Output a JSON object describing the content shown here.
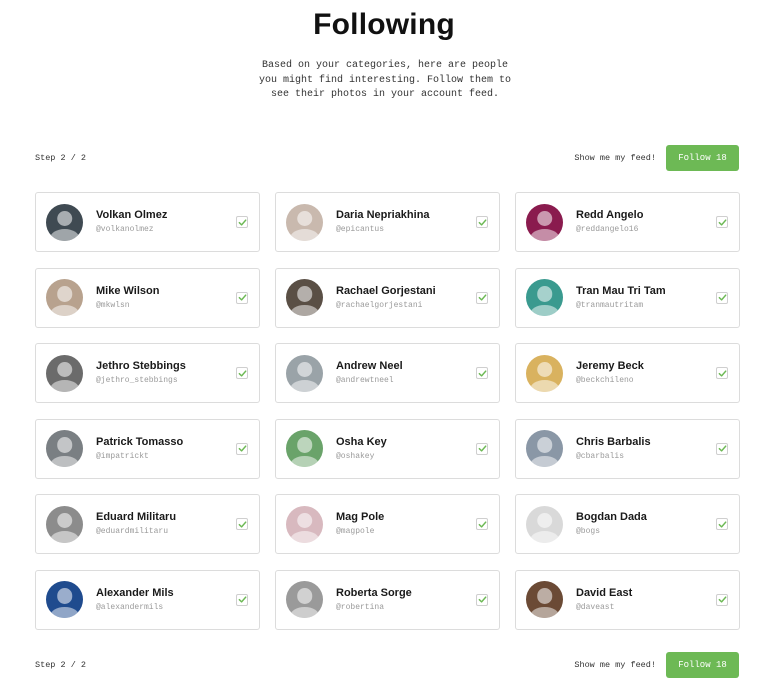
{
  "header": {
    "title": "Following",
    "subtitle": "Based on your categories, here are people you might find interesting. Follow them to see their photos in your account feed."
  },
  "step_bar": {
    "step_text": "Step 2 / 2",
    "feed_link": "Show me my feed!",
    "follow_label": "Follow 18"
  },
  "colors": {
    "accent": "#6db955",
    "check": "#6db955"
  },
  "people": [
    {
      "name": "Volkan Olmez",
      "handle": "@volkanolmez",
      "avatar_bg": "#3f4a52",
      "following": true
    },
    {
      "name": "Daria Nepriakhina",
      "handle": "@epicantus",
      "avatar_bg": "#c9b9ae",
      "following": true
    },
    {
      "name": "Redd Angelo",
      "handle": "@reddangelo16",
      "avatar_bg": "#8a1b4e",
      "following": true
    },
    {
      "name": "Mike Wilson",
      "handle": "@mkwlsn",
      "avatar_bg": "#b8a28e",
      "following": true
    },
    {
      "name": "Rachael Gorjestani",
      "handle": "@rachaelgorjestani",
      "avatar_bg": "#5a4f45",
      "following": true
    },
    {
      "name": "Tran Mau Tri Tam",
      "handle": "@tranmautritam",
      "avatar_bg": "#3a9a8f",
      "following": true
    },
    {
      "name": "Jethro Stebbings",
      "handle": "@jethro_stebbings",
      "avatar_bg": "#6b6b6b",
      "following": true
    },
    {
      "name": "Andrew Neel",
      "handle": "@andrewtneel",
      "avatar_bg": "#9aa3a8",
      "following": true
    },
    {
      "name": "Jeremy Beck",
      "handle": "@beckchileno",
      "avatar_bg": "#d9b25f",
      "following": true
    },
    {
      "name": "Patrick Tomasso",
      "handle": "@impatrickt",
      "avatar_bg": "#7a7f83",
      "following": true
    },
    {
      "name": "Osha Key",
      "handle": "@oshakey",
      "avatar_bg": "#6aa36a",
      "following": true
    },
    {
      "name": "Chris Barbalis",
      "handle": "@cbarbalis",
      "avatar_bg": "#8a97a6",
      "following": true
    },
    {
      "name": "Eduard Militaru",
      "handle": "@eduardmilitaru",
      "avatar_bg": "#8c8c8c",
      "following": true
    },
    {
      "name": "Mag Pole",
      "handle": "@magpole",
      "avatar_bg": "#d8b9bf",
      "following": true
    },
    {
      "name": "Bogdan Dada",
      "handle": "@bogs",
      "avatar_bg": "#d9d9d9",
      "following": true
    },
    {
      "name": "Alexander Mils",
      "handle": "@alexandermils",
      "avatar_bg": "#1f4b8e",
      "following": true
    },
    {
      "name": "Roberta Sorge",
      "handle": "@robertina",
      "avatar_bg": "#9a9a9a",
      "following": true
    },
    {
      "name": "David East",
      "handle": "@daveast",
      "avatar_bg": "#6b4a35",
      "following": true
    }
  ]
}
